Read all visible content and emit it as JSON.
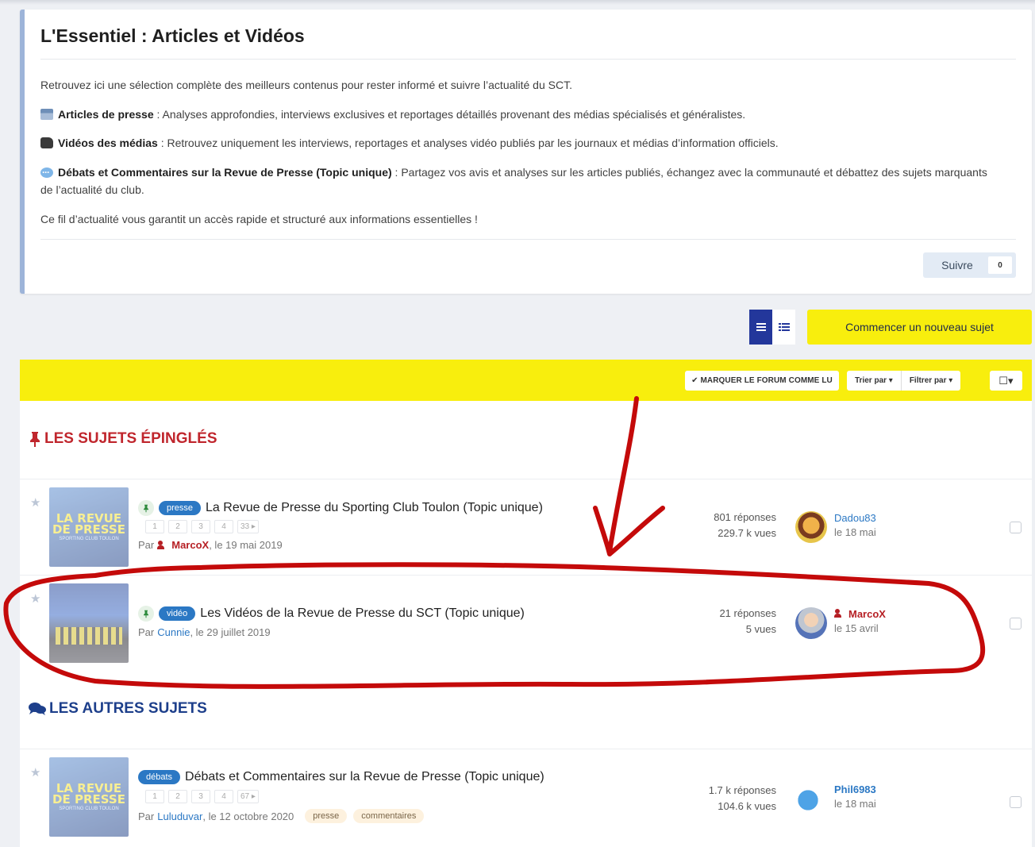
{
  "header": {
    "title": "L'Essentiel : Articles et Vidéos",
    "intro": "Retrouvez ici une sélection complète des meilleurs contenus pour rester informé et suivre l’actualité du SCT.",
    "item1_bold": "Articles de presse",
    "item1_text": " : Analyses approfondies, interviews exclusives et reportages détaillés provenant des médias spécialisés et généralistes.",
    "item2_bold": "Vidéos des médias",
    "item2_text": " : Retrouvez uniquement les interviews, reportages et analyses vidéo publiés par les journaux et médias d’information officiels.",
    "item3_bold": "Débats et Commentaires sur la Revue de Presse (Topic unique)",
    "item3_text": " : Partagez vos avis et analyses sur les articles publiés, échangez avec la communauté et débattez des sujets marquants de l’actualité du club.",
    "outro": "Ce fil d’actualité vous garantit un accès rapide et structuré aux informations essentielles !",
    "follow_label": "Suivre",
    "follow_count": "0"
  },
  "actions": {
    "new_topic": "Commencer un nouveau sujet"
  },
  "toolbar": {
    "mark_read": "✔ Marquer le forum comme lu",
    "sort": "Trier par ▾",
    "filter": "Filtrer par ▾",
    "select": "☐▾"
  },
  "sections": {
    "pinned": "Les sujets épinglés",
    "other": "Les autres sujets"
  },
  "topics": [
    {
      "tag": "presse",
      "title": "La Revue de Presse du Sporting Club Toulon (Topic unique)",
      "pages": [
        "1",
        "2",
        "3",
        "4",
        "33 ▸"
      ],
      "by": "Par",
      "author": "MarcoX",
      "date": ", le 19 mai 2019",
      "replies": "801 réponses",
      "views": "229.7 k vues",
      "last_user": "Dadou83",
      "last_date": "le 18 mai",
      "thumb_line1": "LA REVUE",
      "thumb_line2": "DE PRESSE",
      "thumb_sub": "SPORTING CLUB TOULON"
    },
    {
      "tag": "vidéo",
      "title": "Les Vidéos de la Revue de Presse du SCT (Topic unique)",
      "by": "Par",
      "author": "Cunnie",
      "date": ", le 29 juillet 2019",
      "replies": "21 réponses",
      "views": "5 vues",
      "last_user": "MarcoX",
      "last_date": "le 15 avril"
    },
    {
      "tag": "débats",
      "title": "Débats et Commentaires sur la Revue de Presse (Topic unique)",
      "pages": [
        "1",
        "2",
        "3",
        "4",
        "67 ▸"
      ],
      "by": "Par",
      "author": "Luluduvar",
      "date": ", le 12 octobre 2020",
      "tags": [
        "presse",
        "commentaires"
      ],
      "replies": "1.7 k réponses",
      "views": "104.6 k vues",
      "last_user": "Phil6983",
      "last_date": "le 18 mai",
      "thumb_line1": "LA REVUE",
      "thumb_line2": "DE PRESSE",
      "thumb_sub": "SPORTING CLUB TOULON"
    }
  ],
  "colors": {
    "accent_yellow": "#f8ee0d",
    "pinned_red": "#c0262d",
    "section_blue": "#1d3f8b",
    "link_blue": "#2b78c4",
    "annotation_red": "#c40a0a"
  }
}
